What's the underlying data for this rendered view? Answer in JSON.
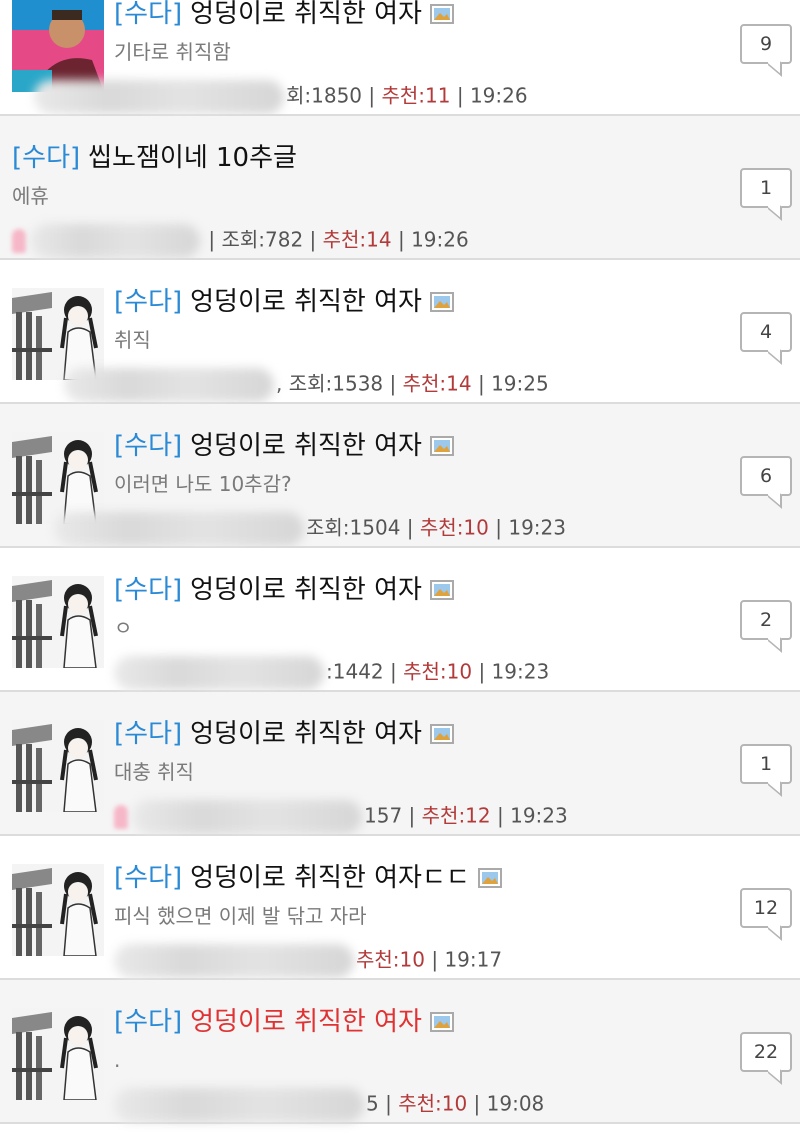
{
  "posts": [
    {
      "prefix": "[수다]",
      "title": "엉덩이로 취직한 여자",
      "has_image": true,
      "subtitle": "기타로 취직함",
      "meta_rest": "회:1850 | ",
      "recommend": "추천:11",
      "time": " | 19:26",
      "comments": "9",
      "thumb": "avatar-man"
    },
    {
      "prefix": "[수다]",
      "title": "씹노잼이네 10추글",
      "has_image": false,
      "subtitle": "에휴",
      "meta_rest": " | 조회:782 | ",
      "recommend": "추천:14",
      "time": " | 19:26",
      "comments": "1",
      "thumb": "none"
    },
    {
      "prefix": "[수다]",
      "title": "엉덩이로 취직한 여자",
      "has_image": true,
      "subtitle": "취직",
      "meta_rest": ", 조회:1538 | ",
      "recommend": "추천:14",
      "time": " | 19:25",
      "comments": "4",
      "thumb": "manga"
    },
    {
      "prefix": "[수다]",
      "title": "엉덩이로 취직한 여자",
      "has_image": true,
      "subtitle": "이러면 나도 10추감?",
      "meta_rest": "조회:1504 | ",
      "recommend": "추천:10",
      "time": " | 19:23",
      "comments": "6",
      "thumb": "manga"
    },
    {
      "prefix": "[수다]",
      "title": "엉덩이로 취직한 여자",
      "has_image": true,
      "subtitle": "ㅇ",
      "meta_rest": ":1442 | ",
      "recommend": "추천:10",
      "time": " | 19:23",
      "comments": "2",
      "thumb": "manga"
    },
    {
      "prefix": "[수다]",
      "title": "엉덩이로 취직한 여자",
      "has_image": true,
      "subtitle": "대충 취직",
      "meta_rest": "157 | ",
      "recommend": "추천:12",
      "time": " | 19:23",
      "comments": "1",
      "thumb": "manga"
    },
    {
      "prefix": "[수다]",
      "title": "엉덩이로 취직한 여자ㄷㄷ",
      "has_image": true,
      "subtitle": "피식 했으면 이제 발 닦고 자라",
      "meta_rest": "",
      "recommend": "추천:10",
      "time": " | 19:17",
      "comments": "12",
      "thumb": "manga"
    },
    {
      "prefix": "[수다]",
      "title": "엉덩이로 취직한 여자",
      "has_image": true,
      "subtitle": ".",
      "meta_rest": "5 | ",
      "recommend": "추천:10",
      "time": " | 19:08",
      "comments": "22",
      "thumb": "manga",
      "title_red": true
    }
  ],
  "colors": {
    "prefix": "#2b8ad6",
    "recommend": "#b23a3a",
    "hot_title": "#e03232"
  }
}
